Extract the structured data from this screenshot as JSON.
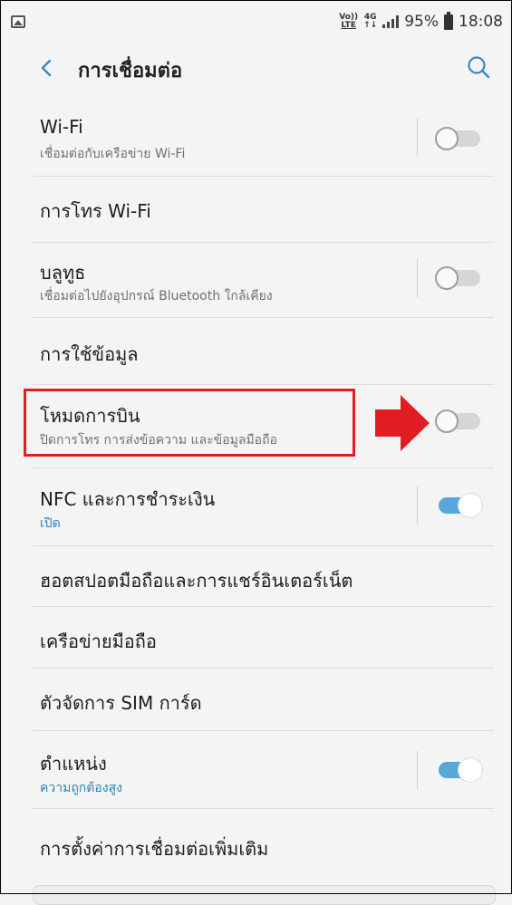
{
  "status_bar": {
    "volte_top": "Vo))",
    "volte_bottom": "LTE",
    "network_top": "4G",
    "network_bottom": "↑↓",
    "battery_percent": "95%",
    "time": "18:08"
  },
  "header": {
    "title": "การเชื่อมต่อ"
  },
  "items": [
    {
      "title": "Wi-Fi",
      "subtitle": "เชื่อมต่อกับเครือข่าย Wi-Fi",
      "toggle": "off"
    },
    {
      "title": "การโทร Wi-Fi"
    },
    {
      "title": "บลูทูธ",
      "subtitle": "เชื่อมต่อไปยังอุปกรณ์ Bluetooth ใกล้เคียง",
      "toggle": "off"
    },
    {
      "title": "การใช้ข้อมูล"
    },
    {
      "title": "โหมดการบิน",
      "subtitle": "ปิดการโทร การส่งข้อความ และข้อมูลมือถือ",
      "toggle": "off",
      "highlighted": true
    },
    {
      "title": "NFC และการชำระเงิน",
      "subtitle": "เปิด",
      "toggle": "on"
    },
    {
      "title": "ฮอตสปอตมือถือและการแชร์อินเตอร์เน็ต"
    },
    {
      "title": "เครือข่ายมือถือ"
    },
    {
      "title": "ตัวจัดการ SIM การ์ด"
    },
    {
      "title": "ตำแหน่ง",
      "subtitle": "ความถูกต้องสูง",
      "toggle": "on"
    },
    {
      "title": "การตั้งค่าการเชื่อมต่อเพิ่มเติม"
    }
  ],
  "colors": {
    "accent": "#57a7d9",
    "highlight": "#e21c23",
    "subtitle_blue": "#2b83b8"
  }
}
